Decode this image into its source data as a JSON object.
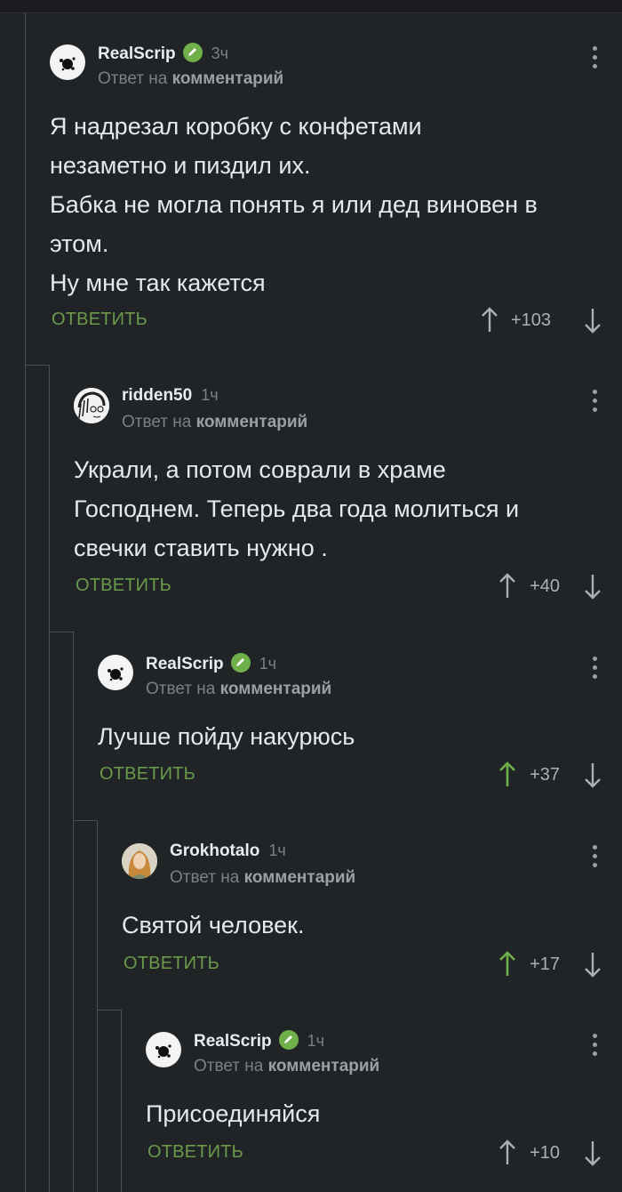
{
  "comments": [
    {
      "author": "RealScrip",
      "verified": true,
      "time": "3ч",
      "reply_prefix": "Ответ на",
      "reply_target": "комментарий",
      "text_lines": [
        "Я надрезал коробку с конфетами",
        "незаметно и пиздил их.",
        "Бабка не могла понять я или дед виновен в",
        "этом.",
        "Ну мне так кажется"
      ],
      "reply_label": "ОТВЕТИТЬ",
      "score": "+103",
      "upvoted": false,
      "avatar": "ink-blot-avatar"
    },
    {
      "author": "ridden50",
      "verified": false,
      "time": "1ч",
      "reply_prefix": "Ответ на",
      "reply_target": "комментарий",
      "text_lines": [
        "Украли, а потом соврали в храме",
        "Господнем. Теперь два года молиться и",
        "свечки ставить нужно ."
      ],
      "reply_label": "ОТВЕТИТЬ",
      "score": "+40",
      "upvoted": false,
      "avatar": "sketch-face-avatar"
    },
    {
      "author": "RealScrip",
      "verified": true,
      "time": "1ч",
      "reply_prefix": "Ответ на",
      "reply_target": "комментарий",
      "text_lines": [
        "Лучше пойду накурюсь"
      ],
      "reply_label": "ОТВЕТИТЬ",
      "score": "+37",
      "upvoted": true,
      "avatar": "ink-blot-avatar"
    },
    {
      "author": "Grokhotalo",
      "verified": false,
      "time": "1ч",
      "reply_prefix": "Ответ на",
      "reply_target": "комментарий",
      "text_lines": [
        "Святой человек."
      ],
      "reply_label": "ОТВЕТИТЬ",
      "score": "+17",
      "upvoted": true,
      "avatar": "photo-woman-avatar"
    },
    {
      "author": "RealScrip",
      "verified": true,
      "time": "1ч",
      "reply_prefix": "Ответ на",
      "reply_target": "комментарий",
      "text_lines": [
        "Присоединяйся"
      ],
      "reply_label": "ОТВЕТИТЬ",
      "score": "+10",
      "upvoted": false,
      "avatar": "ink-blot-avatar"
    }
  ],
  "colors": {
    "background": "#212427",
    "reply_green": "#6a9a4a",
    "upvote_green": "#6fb04a",
    "verified_green": "#6fb04a",
    "thread_line": "#4a4f55"
  }
}
